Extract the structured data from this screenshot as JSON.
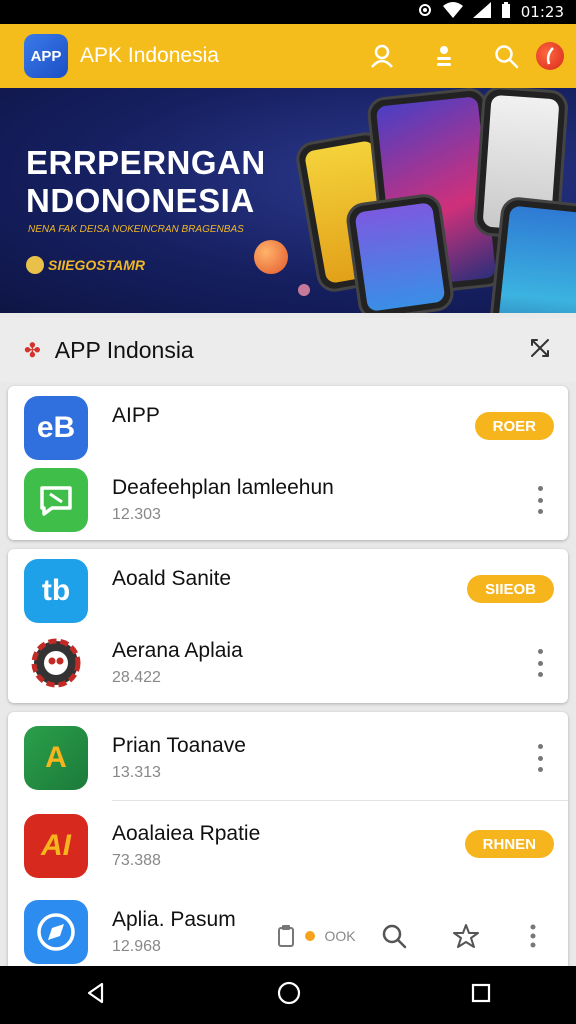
{
  "status_bar": {
    "time": "01:23"
  },
  "app_bar": {
    "logo_text": "APP",
    "title": "APK Indonesia"
  },
  "banner": {
    "headline_1": "ERRPERNGAN",
    "headline_2": "NDONONESIA",
    "tagline": "NENA FAK DEISA NOKEINCRAN BRAGENBAS",
    "sub_brand": "SIIEGOSTAMR"
  },
  "section": {
    "title": "APP Indonsia"
  },
  "cards": [
    {
      "rows": [
        {
          "name": "AIPP",
          "meta": "",
          "chip": "ROER",
          "icon_text": "eB",
          "icon_color": "#2f6fde"
        },
        {
          "name": "Deafeehplan lamleehun",
          "meta": "12.303",
          "chip": "",
          "icon_text": "",
          "icon_color": "#3fbe4a"
        }
      ]
    },
    {
      "rows": [
        {
          "name": "Aoald Sanite",
          "meta": "",
          "chip": "SIIEOB",
          "icon_text": "tb",
          "icon_color": "#1fa1ea"
        },
        {
          "name": "Aerana Aplaia",
          "meta": "28.422",
          "chip": "",
          "icon_text": "",
          "icon_color": "#333333"
        }
      ]
    },
    {
      "rows": [
        {
          "name": "Prian Toanave",
          "meta": "13.313",
          "chip": "",
          "icon_text": "A",
          "icon_color": "#2aa04a"
        },
        {
          "name": "Aoalaiea Rpatie",
          "meta": "73.388",
          "chip": "RHNEN",
          "icon_text": "AI",
          "icon_color": "#d8291f"
        },
        {
          "name": "Aplia. Pasum",
          "meta": "12.968",
          "chip": "",
          "icon_text": "",
          "icon_color": "#2d8cf0"
        }
      ]
    }
  ],
  "bottom_tools": {
    "label": "OOK"
  },
  "colors": {
    "accent": "#f5bd1c",
    "chip": "#f6b51d",
    "banner": "#162061"
  }
}
